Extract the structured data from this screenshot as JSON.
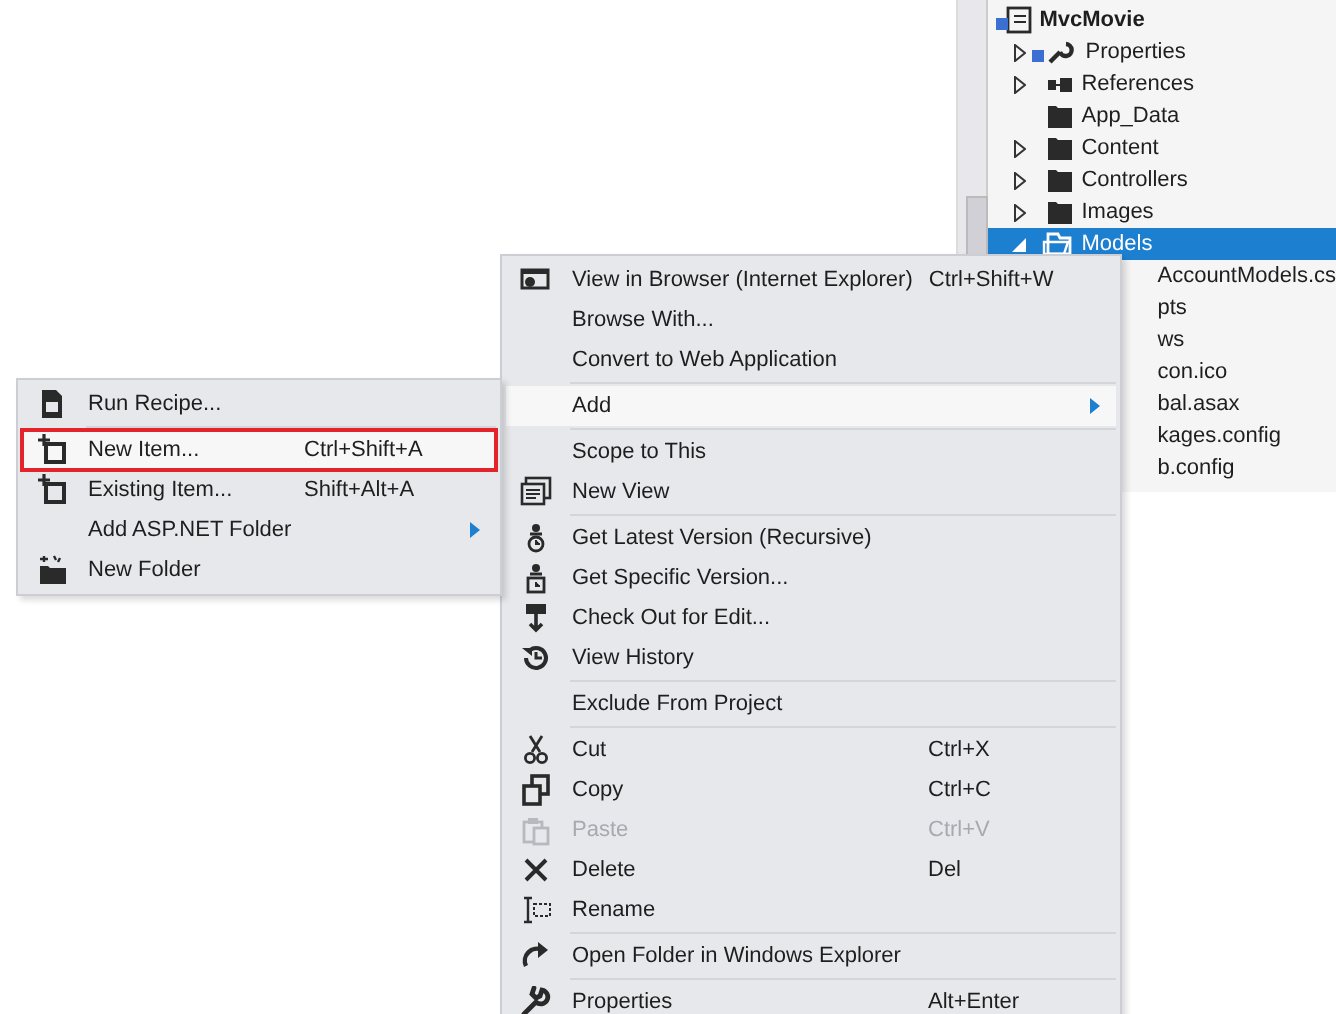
{
  "solution_explorer": {
    "root": {
      "label": "MvcMovie",
      "children": [
        {
          "label": "Properties",
          "expanded": false,
          "selected": false
        },
        {
          "label": "References",
          "expanded": false,
          "selected": false
        },
        {
          "label": "App_Data",
          "selected": false
        },
        {
          "label": "Content",
          "expanded": false,
          "selected": false
        },
        {
          "label": "Controllers",
          "expanded": false,
          "selected": false
        },
        {
          "label": "Images",
          "expanded": false,
          "selected": false
        },
        {
          "label": "Models",
          "expanded": true,
          "selected": true,
          "children": [
            {
              "label": "AccountModels.cs"
            },
            {
              "label": "pts"
            },
            {
              "label": "ws"
            },
            {
              "label": "con.ico"
            },
            {
              "label": "bal.asax"
            },
            {
              "label": "kages.config"
            },
            {
              "label": "b.config"
            }
          ]
        }
      ]
    }
  },
  "context_menu": {
    "groups": [
      [
        {
          "label": "View in Browser (Internet Explorer)",
          "shortcut": "Ctrl+Shift+W",
          "selected": false,
          "disabled": false,
          "has_submenu": false
        },
        {
          "label": "Browse With...",
          "selected": false,
          "disabled": false,
          "has_submenu": false
        },
        {
          "label": "Convert to Web Application",
          "selected": false,
          "disabled": false,
          "has_submenu": false
        }
      ],
      [
        {
          "label": "Add",
          "selected": true,
          "disabled": false,
          "has_submenu": true
        }
      ],
      [
        {
          "label": "Scope to This",
          "selected": false,
          "disabled": false,
          "has_submenu": false
        },
        {
          "label": "New View",
          "selected": false,
          "disabled": false,
          "has_submenu": false
        }
      ],
      [
        {
          "label": "Get Latest Version (Recursive)",
          "selected": false,
          "disabled": false,
          "has_submenu": false
        },
        {
          "label": "Get Specific Version...",
          "selected": false,
          "disabled": false,
          "has_submenu": false
        },
        {
          "label": "Check Out for Edit...",
          "selected": false,
          "disabled": false,
          "has_submenu": false
        },
        {
          "label": "View History",
          "selected": false,
          "disabled": false,
          "has_submenu": false
        }
      ],
      [
        {
          "label": "Exclude From Project",
          "selected": false,
          "disabled": false,
          "has_submenu": false
        }
      ],
      [
        {
          "label": "Cut",
          "shortcut": "Ctrl+X",
          "selected": false,
          "disabled": false,
          "has_submenu": false
        },
        {
          "label": "Copy",
          "shortcut": "Ctrl+C",
          "selected": false,
          "disabled": false,
          "has_submenu": false
        },
        {
          "label": "Paste",
          "shortcut": "Ctrl+V",
          "selected": false,
          "disabled": true,
          "has_submenu": false
        },
        {
          "label": "Delete",
          "shortcut": "Del",
          "selected": false,
          "disabled": false,
          "has_submenu": false
        },
        {
          "label": "Rename",
          "selected": false,
          "disabled": false,
          "has_submenu": false
        }
      ],
      [
        {
          "label": "Open Folder in Windows Explorer",
          "selected": false,
          "disabled": false,
          "has_submenu": false
        }
      ],
      [
        {
          "label": "Properties",
          "shortcut": "Alt+Enter",
          "selected": false,
          "disabled": false,
          "has_submenu": false
        }
      ]
    ]
  },
  "add_submenu": {
    "groups": [
      [
        {
          "label": "Run Recipe...",
          "selected": false,
          "outlined": false,
          "has_submenu": false
        }
      ],
      [
        {
          "label": "New Item...",
          "shortcut": "Ctrl+Shift+A",
          "selected": true,
          "outlined": true,
          "has_submenu": false
        },
        {
          "label": "Existing Item...",
          "shortcut": "Shift+Alt+A",
          "selected": false,
          "outlined": false,
          "has_submenu": false
        },
        {
          "label": "Add ASP.NET Folder",
          "selected": false,
          "outlined": false,
          "has_submenu": true
        },
        {
          "label": "New Folder",
          "selected": false,
          "outlined": false,
          "has_submenu": false
        }
      ]
    ]
  }
}
